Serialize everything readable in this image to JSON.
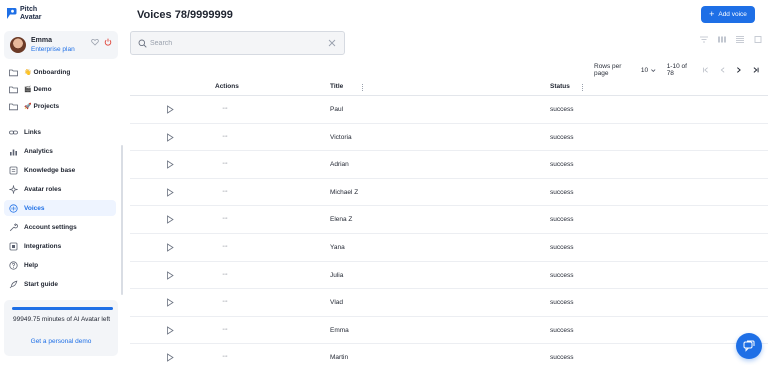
{
  "brand": {
    "line1": "Pitch",
    "line2": "Avatar"
  },
  "user": {
    "name": "Emma",
    "plan": "Enterprise plan"
  },
  "sidebar": {
    "folders": [
      {
        "emoji": "👋",
        "label": "Onboarding",
        "icon": "folder-icon"
      },
      {
        "emoji": "🎬",
        "label": "Demo",
        "icon": "folder-icon"
      },
      {
        "emoji": "🚀",
        "label": "Projects",
        "icon": "folder-icon"
      }
    ],
    "items": [
      {
        "label": "Links",
        "icon": "link-icon",
        "active": false
      },
      {
        "label": "Analytics",
        "icon": "analytics-icon",
        "active": false
      },
      {
        "label": "Knowledge base",
        "icon": "book-icon",
        "active": false
      },
      {
        "label": "Avatar roles",
        "icon": "sparkle-icon",
        "active": false
      },
      {
        "label": "Voices",
        "icon": "voice-icon",
        "active": true
      },
      {
        "label": "Account settings",
        "icon": "wrench-icon",
        "active": false
      },
      {
        "label": "Integrations",
        "icon": "integrations-icon",
        "active": false
      },
      {
        "label": "Help",
        "icon": "help-icon",
        "active": false
      },
      {
        "label": "Start guide",
        "icon": "rocket-icon",
        "active": false
      }
    ],
    "minutes": {
      "text": "99949.75 minutes of AI Avatar left",
      "progress": 0.999,
      "link": "Get a personal demo"
    }
  },
  "main": {
    "title": "Voices 78/9999999",
    "add_button": "Add voice",
    "search": {
      "placeholder": "Search",
      "value": ""
    },
    "pagination": {
      "rows_label": "Rows per page",
      "rows_value": "10",
      "range": "1-10 of 78"
    },
    "columns": {
      "actions": "Actions",
      "title": "Title",
      "status": "Status"
    },
    "rows": [
      {
        "title": "Paul",
        "status": "success"
      },
      {
        "title": "Victoria",
        "status": "success"
      },
      {
        "title": "Adrian",
        "status": "success"
      },
      {
        "title": "Michael Z",
        "status": "success"
      },
      {
        "title": "Elena Z",
        "status": "success"
      },
      {
        "title": "Yana",
        "status": "success"
      },
      {
        "title": "Julia",
        "status": "success"
      },
      {
        "title": "Vlad",
        "status": "success"
      },
      {
        "title": "Emma",
        "status": "success"
      },
      {
        "title": "Martin",
        "status": "success"
      }
    ],
    "more_glyph": "···"
  },
  "colors": {
    "accent": "#1e6fe6",
    "text": "#1f2430",
    "muted": "#9aa1ad"
  }
}
